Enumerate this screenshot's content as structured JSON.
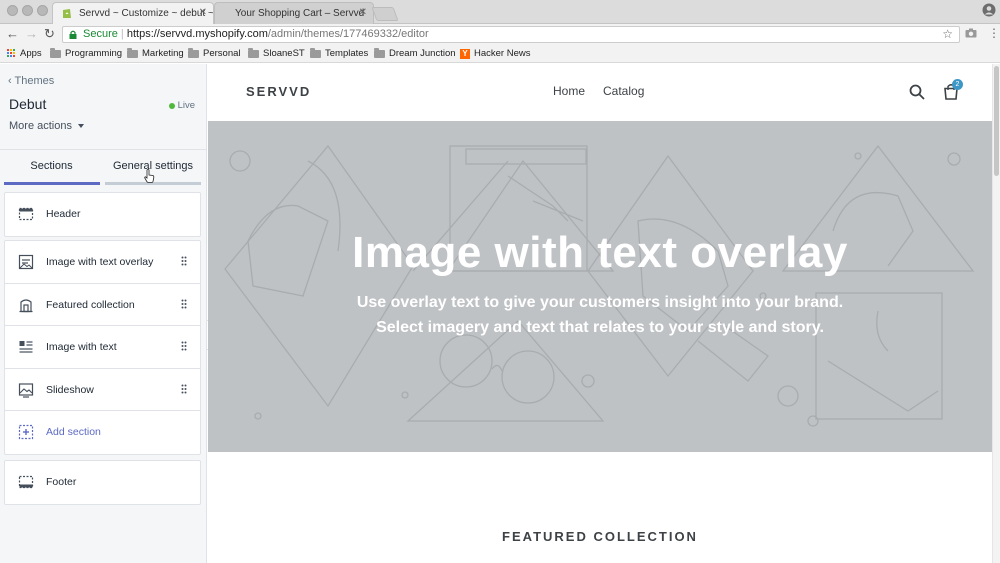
{
  "browser": {
    "tabs": [
      {
        "title": "Servvd ~ Customize ~ debut ~",
        "active": true
      },
      {
        "title": "Your Shopping Cart – Servvd",
        "active": false
      }
    ],
    "omnibox": {
      "secure_label": "Secure",
      "url_host": "https://servvd.myshopify.com",
      "url_path": "/admin/themes/177469332/editor"
    },
    "bookmarks": [
      {
        "label": "Apps",
        "icon": "apps-grid-icon"
      },
      {
        "label": "Programming",
        "icon": "folder-icon"
      },
      {
        "label": "Marketing",
        "icon": "folder-icon"
      },
      {
        "label": "Personal",
        "icon": "folder-icon"
      },
      {
        "label": "SloaneST",
        "icon": "folder-icon"
      },
      {
        "label": "Templates",
        "icon": "folder-icon"
      },
      {
        "label": "Dream Junction",
        "icon": "folder-icon"
      },
      {
        "label": "Hacker News",
        "icon": "hacker-news-icon"
      }
    ]
  },
  "sidebar": {
    "back_label": "Themes",
    "theme_name": "Debut",
    "status": "Live",
    "more_actions": "More actions",
    "tabs": [
      {
        "label": "Sections",
        "active": true
      },
      {
        "label": "General settings",
        "active": false
      }
    ],
    "header_section": {
      "label": "Header",
      "icon": "header-layout-icon"
    },
    "sections": [
      {
        "label": "Image with text overlay",
        "icon": "image-overlay-icon"
      },
      {
        "label": "Featured collection",
        "icon": "collection-icon"
      },
      {
        "label": "Image with text",
        "icon": "image-text-icon"
      },
      {
        "label": "Slideshow",
        "icon": "slideshow-icon"
      }
    ],
    "add_section": "Add section",
    "footer_section": {
      "label": "Footer",
      "icon": "footer-layout-icon"
    }
  },
  "preview": {
    "store_name": "SERVVD",
    "nav": [
      "Home",
      "Catalog"
    ],
    "cart_count": "2",
    "hero_title": "Image with text overlay",
    "hero_sub_1": "Use overlay text to give your customers insight into your brand.",
    "hero_sub_2": "Select imagery and text that relates to your style and story.",
    "featured_heading": "FEATURED COLLECTION"
  },
  "colors": {
    "accent": "#5c6ac4",
    "hero_bg": "#bfc2c5",
    "live_dot": "#50b83c",
    "badge": "#3d97c6"
  }
}
